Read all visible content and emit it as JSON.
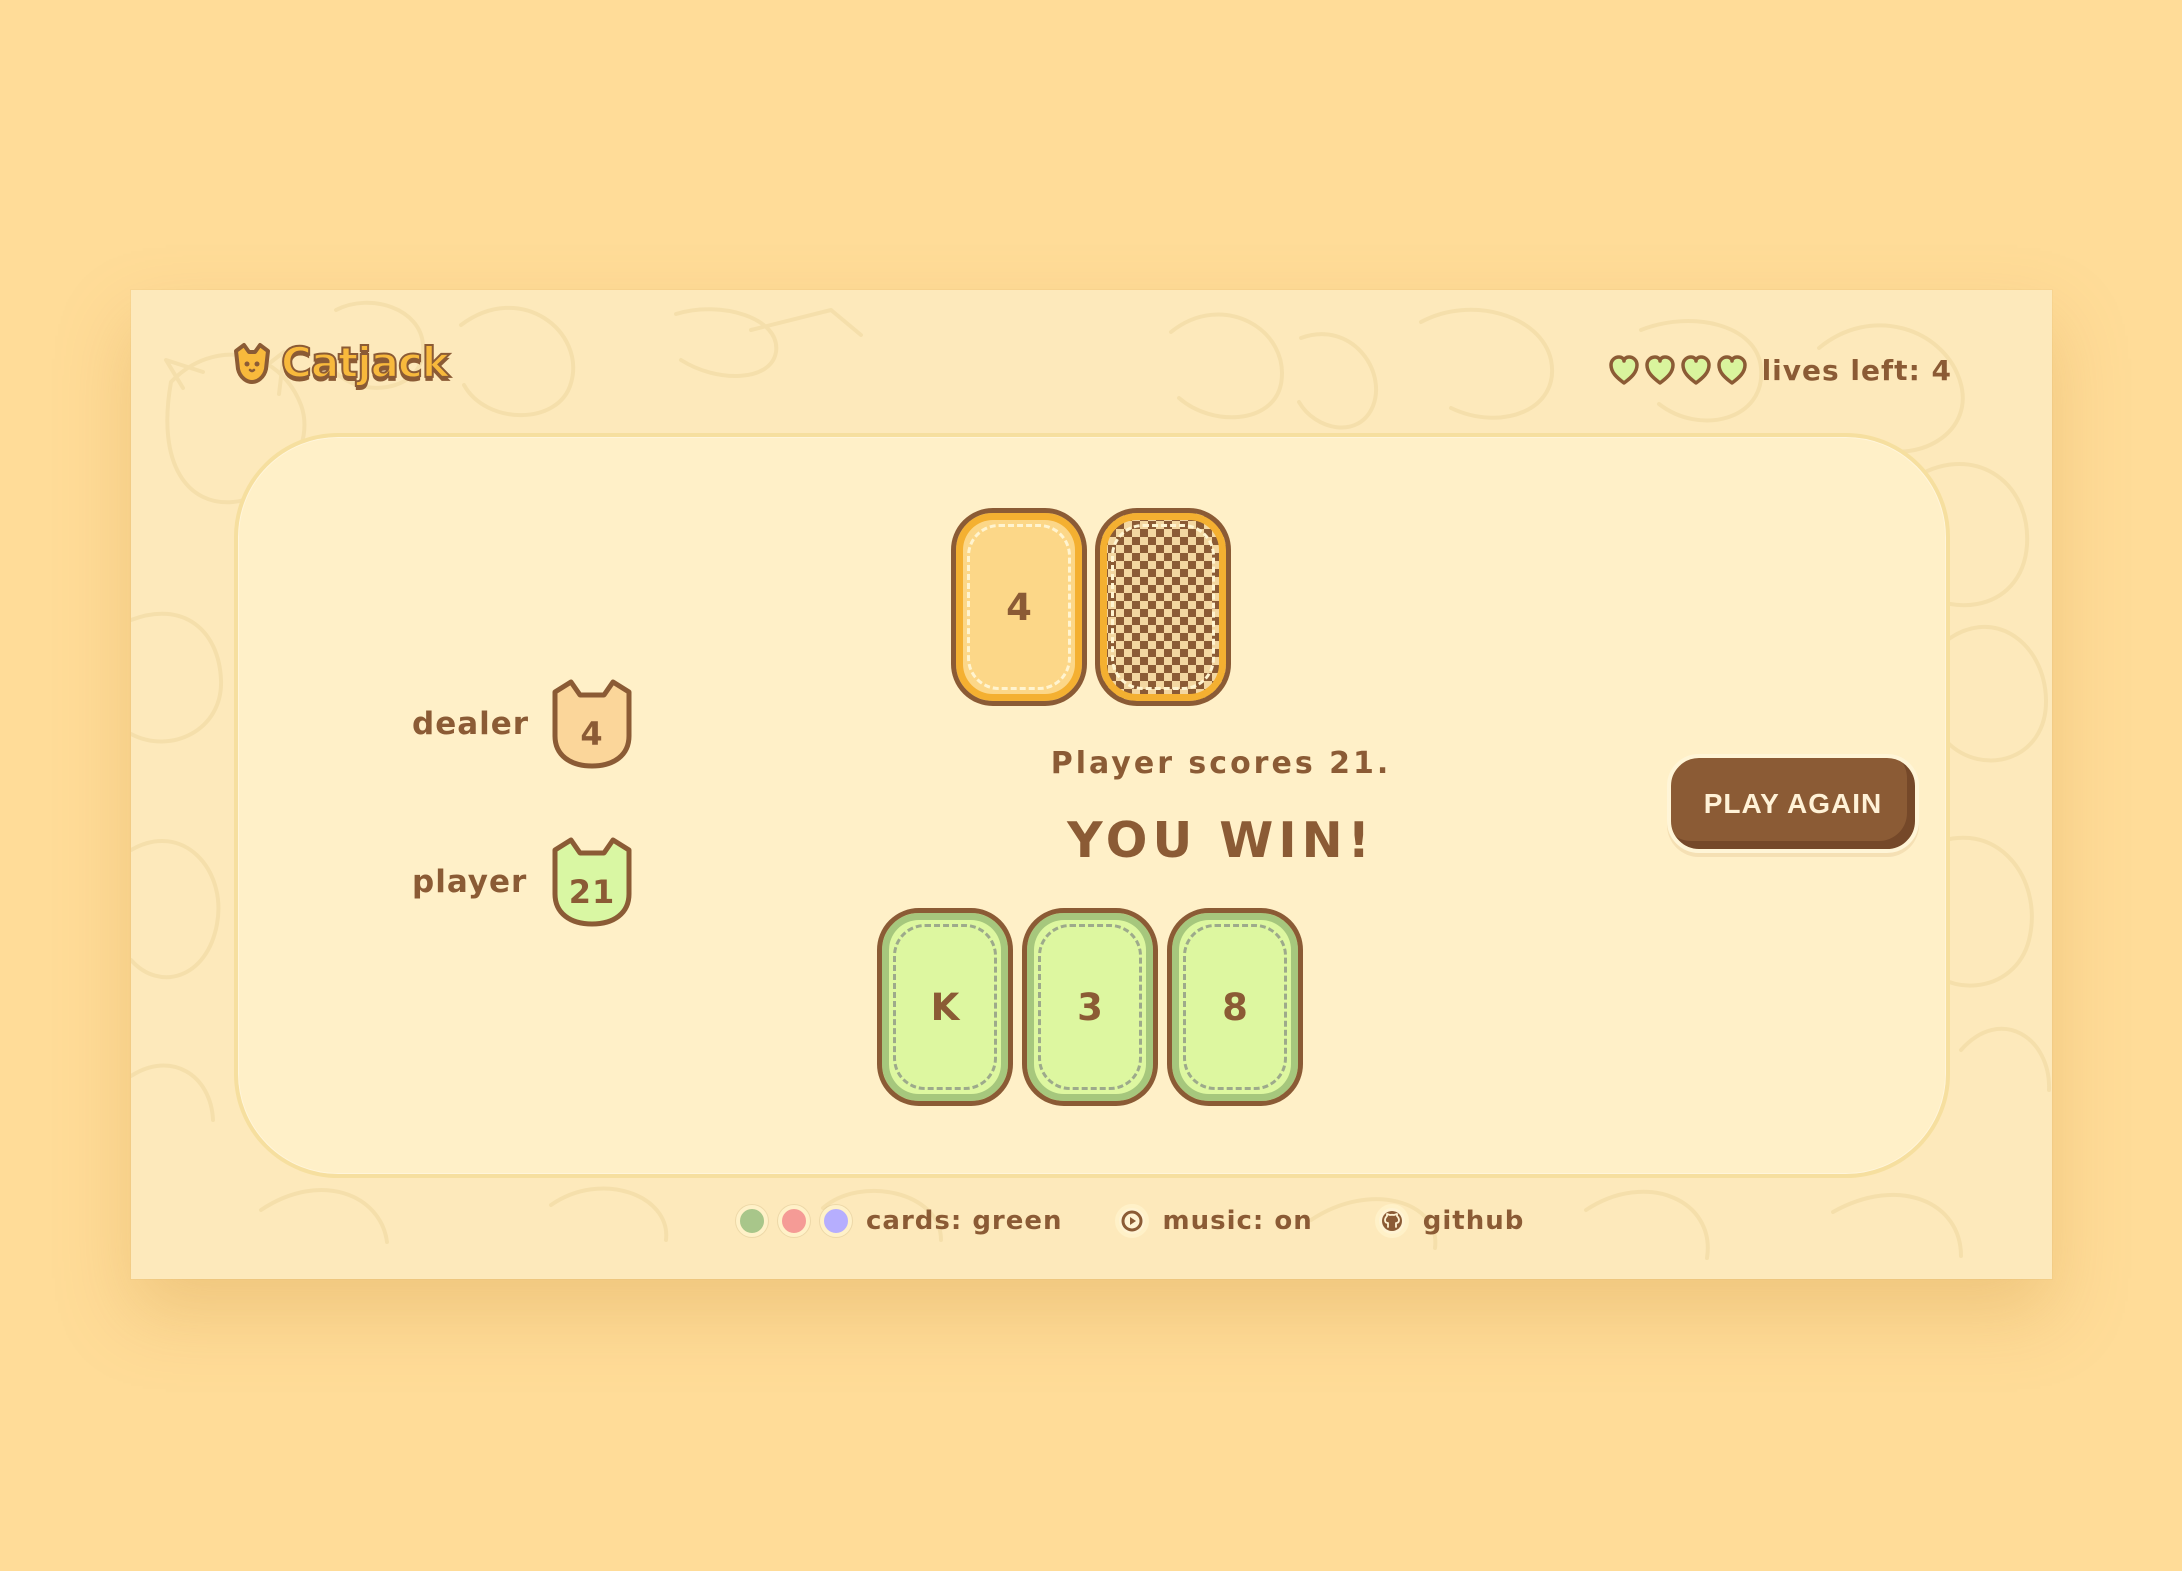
{
  "app": {
    "title": "Catjack"
  },
  "header": {
    "lives_text": "lives left: 4",
    "hearts": [
      {
        "icon": "heart-icon"
      },
      {
        "icon": "heart-icon"
      },
      {
        "icon": "heart-icon"
      },
      {
        "icon": "heart-icon"
      }
    ]
  },
  "scores": {
    "dealer_label": "dealer",
    "dealer_value": "4",
    "player_label": "player",
    "player_value": "21"
  },
  "dealer_cards": [
    {
      "value": "4",
      "state": "face-up"
    },
    {
      "value": "",
      "state": "face-down"
    }
  ],
  "player_cards": [
    {
      "value": "K"
    },
    {
      "value": "3"
    },
    {
      "value": "8"
    }
  ],
  "message": {
    "subtitle": "Player scores 21.",
    "result": "YOU WIN!"
  },
  "actions": {
    "play_again": "PLAY AGAIN"
  },
  "footer": {
    "card_colors": [
      {
        "name": "green",
        "color": "#a8c68a"
      },
      {
        "name": "red",
        "color": "#f59b96"
      },
      {
        "name": "blue",
        "color": "#b6aefe"
      }
    ],
    "cards_text": "cards: green",
    "music_text": "music: on",
    "github_text": "github",
    "icons": {
      "music": "play-icon",
      "github": "github-icon"
    }
  },
  "theme": {
    "background": "#ffdc98",
    "panel": "#fde9bb",
    "table": "#fff0c8",
    "brown": "#8b5b35",
    "dealer_card": "#fcd788",
    "player_card": "#ddf7a0"
  }
}
